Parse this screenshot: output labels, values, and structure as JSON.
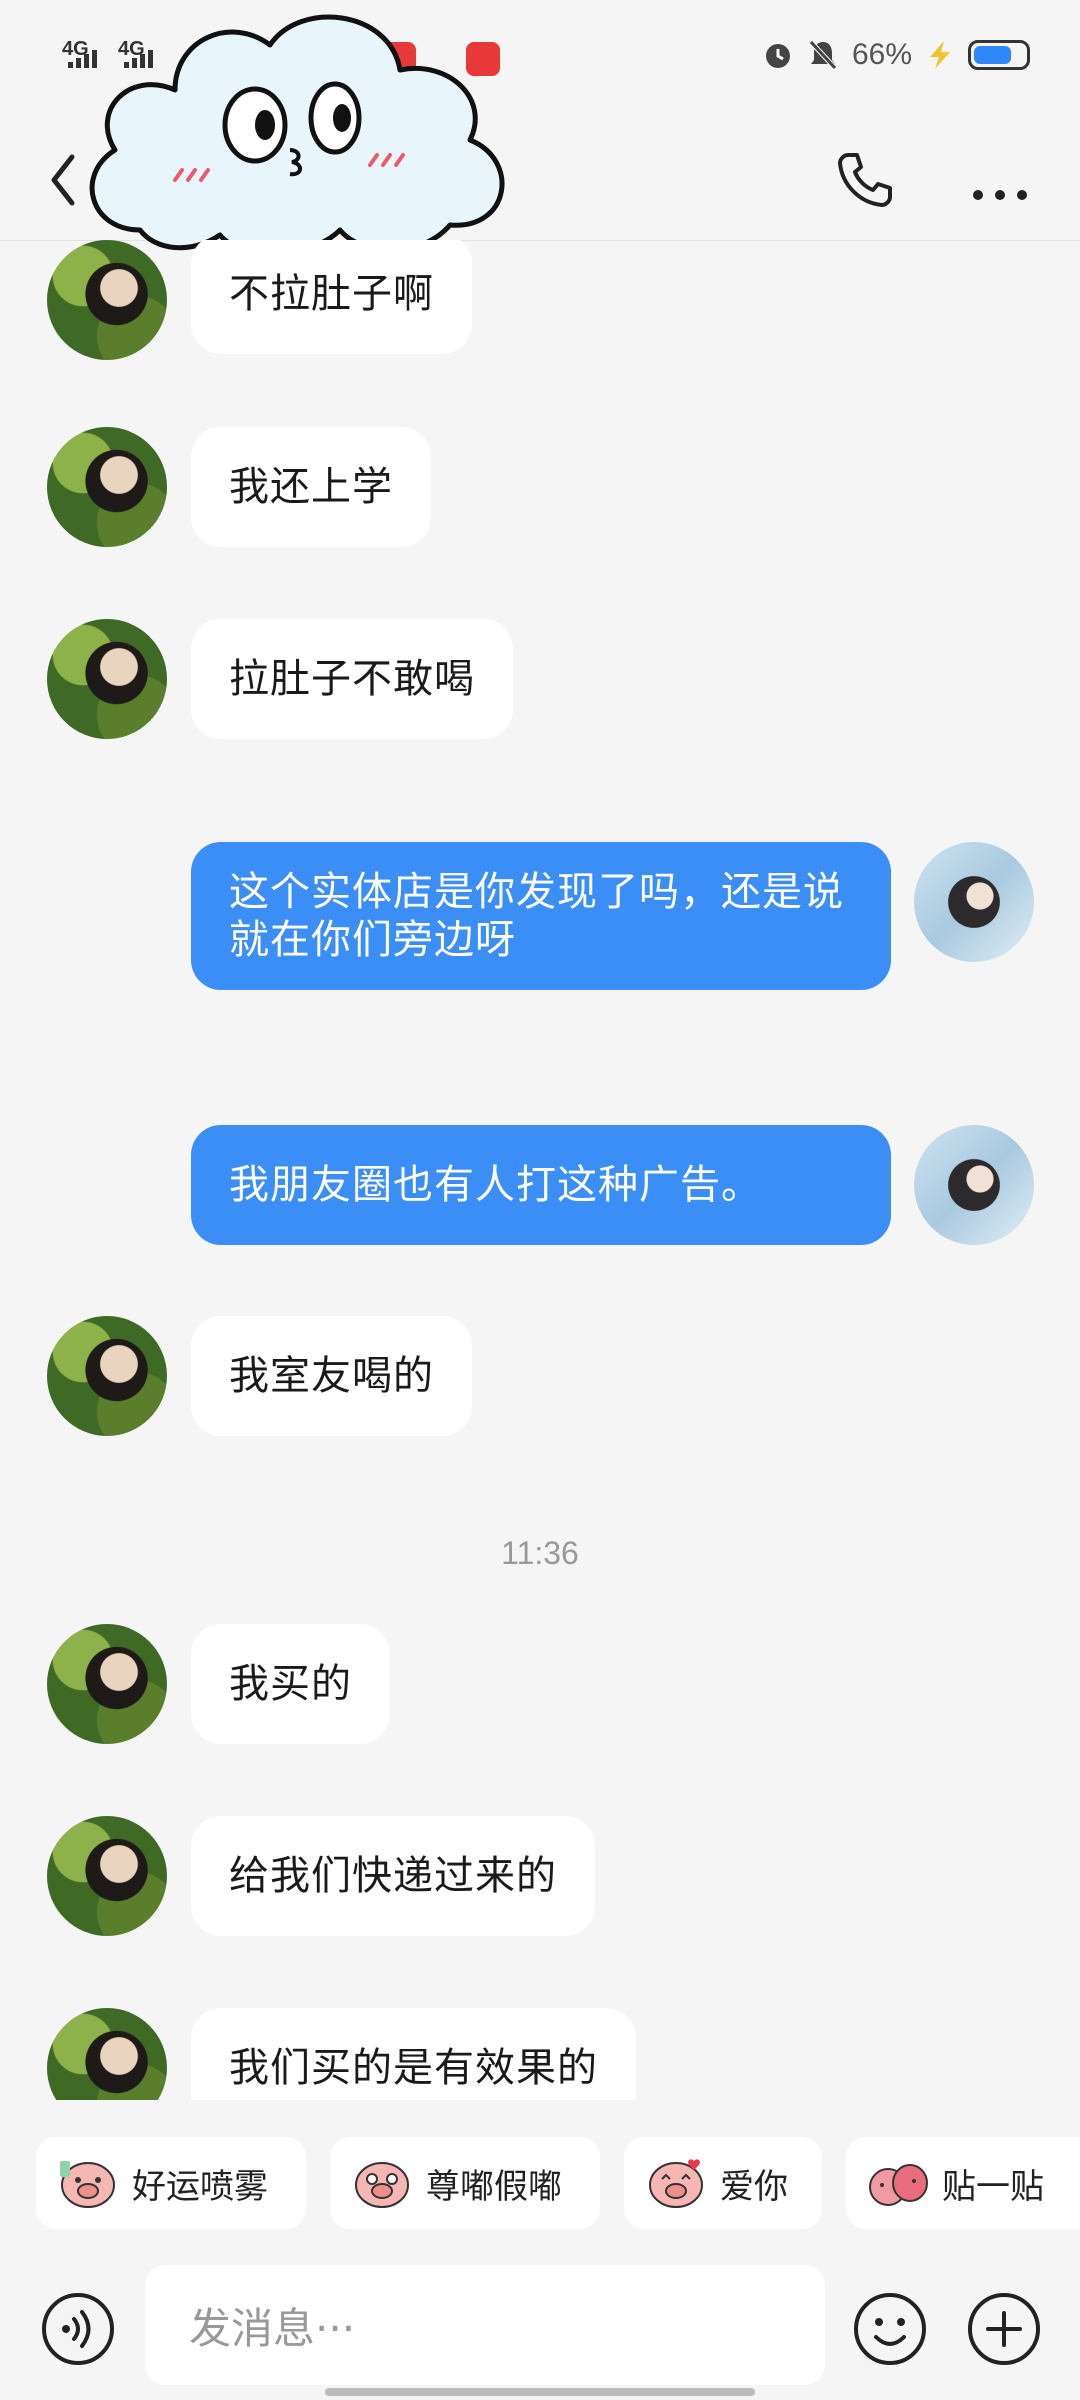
{
  "status_bar": {
    "network1": "4G",
    "network2": "4G",
    "battery_percent": "66%",
    "battery_level": 0.66,
    "icons": [
      "alarm-icon",
      "mute-bell-icon",
      "charging-icon",
      "battery-icon"
    ]
  },
  "header": {
    "back_icon": "chevron-left-icon",
    "call_icon": "phone-icon",
    "more_icon": "more-dots-icon"
  },
  "messages": [
    {
      "side": "other",
      "text": "不拉肚子啊"
    },
    {
      "side": "other",
      "text": "我还上学"
    },
    {
      "side": "other",
      "text": "拉肚子不敢喝"
    },
    {
      "side": "me",
      "text": "这个实体店是你发现了吗，还是说就在你们旁边呀"
    },
    {
      "side": "me",
      "text": "我朋友圈也有人打这种广告。"
    },
    {
      "side": "other",
      "text": "我室友喝的"
    },
    {
      "side": "other",
      "text": "我买的"
    },
    {
      "side": "other",
      "text": "给我们快递过来的"
    },
    {
      "side": "other",
      "text": "我们买的是有效果的"
    }
  ],
  "timestamp": "11:36",
  "quick_stickers": [
    {
      "label": "好运喷雾",
      "icon": "pig-sticker-icon"
    },
    {
      "label": "尊嘟假嘟",
      "icon": "pig-sticker-icon"
    },
    {
      "label": "爱你",
      "icon": "pig-sticker-icon"
    },
    {
      "label": "贴一贴",
      "icon": "pig-pair-sticker-icon"
    }
  ],
  "input": {
    "placeholder": "发消息···"
  },
  "colors": {
    "accent": "#3b8ef5",
    "background": "#f5f5f5",
    "bubble_other": "#ffffff"
  }
}
